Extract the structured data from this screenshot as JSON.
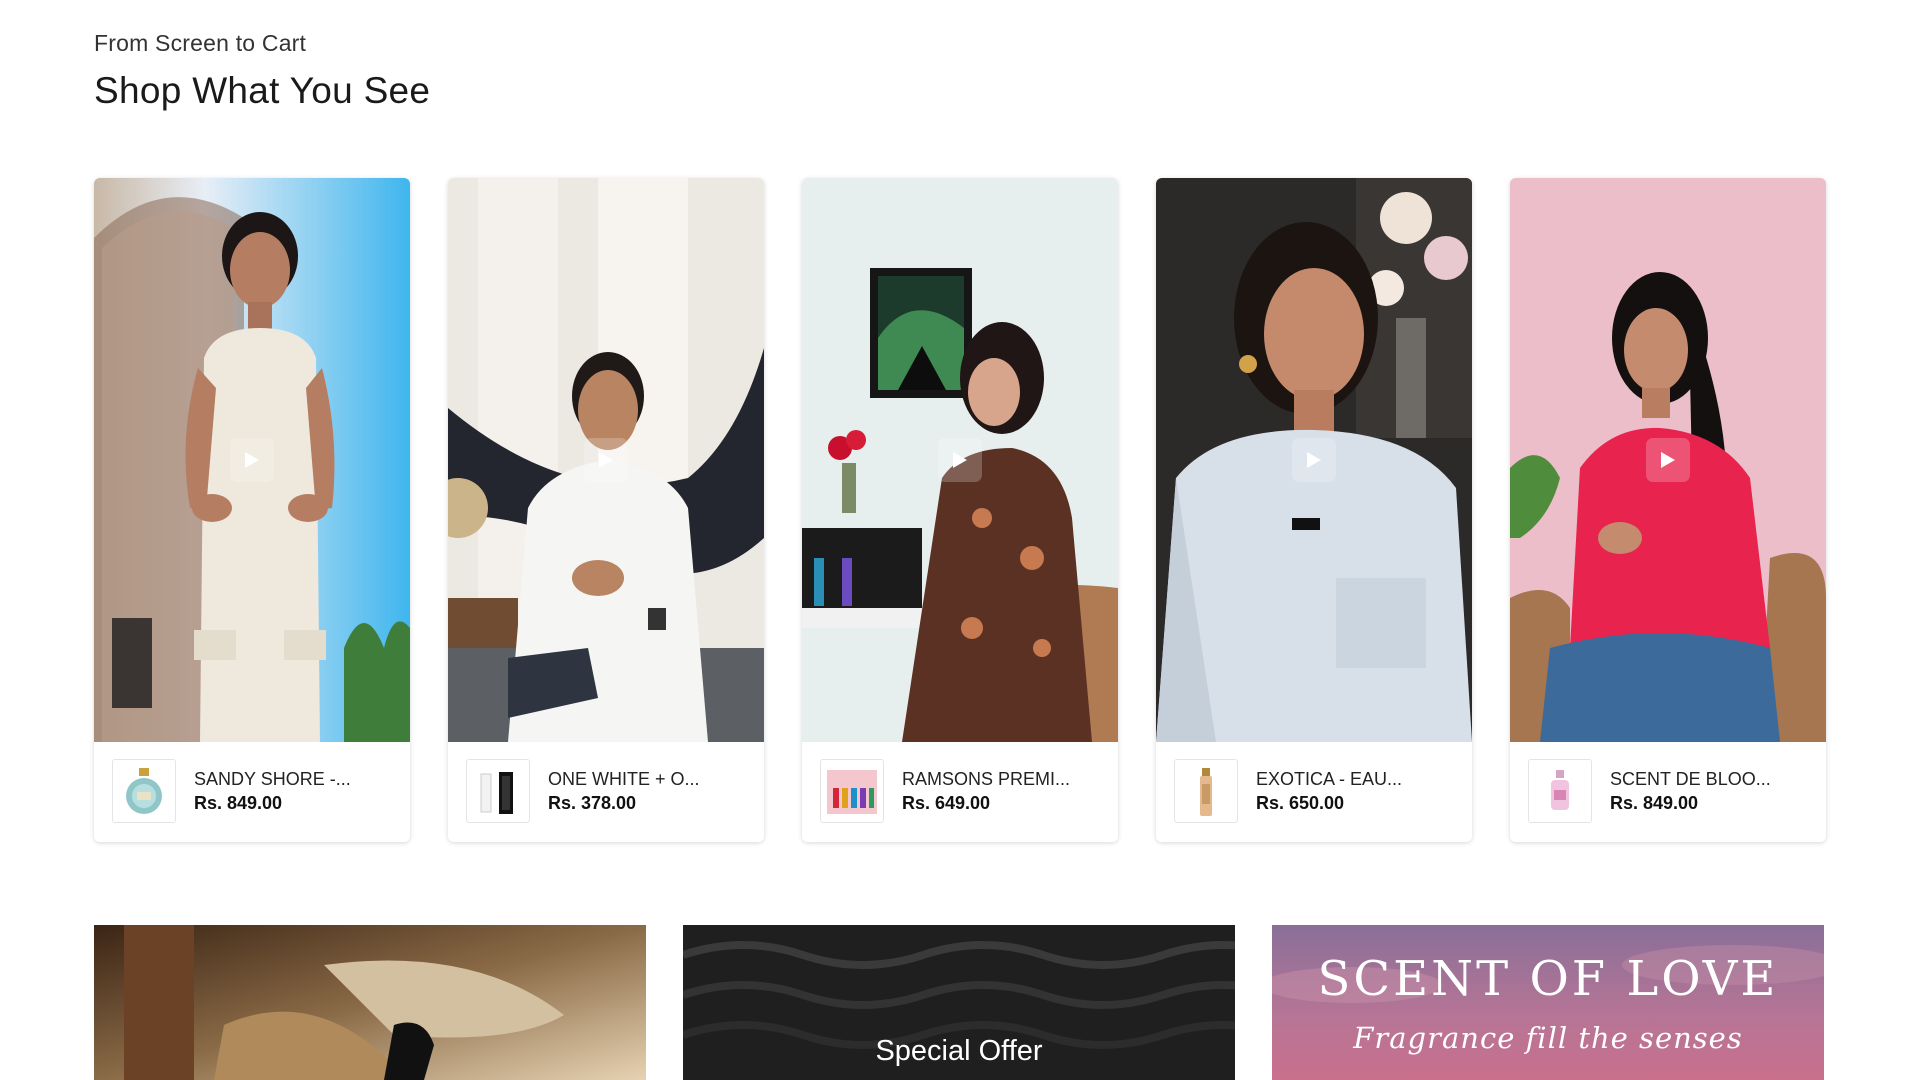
{
  "section": {
    "eyebrow": "From Screen to Cart",
    "title": "Shop What You See"
  },
  "videos": [
    {
      "product_name": "SANDY SHORE -...",
      "price": "Rs. 849.00",
      "icon": "play-icon",
      "backdrop": "#dfe9f4"
    },
    {
      "product_name": "ONE WHITE + O...",
      "price": "Rs. 378.00",
      "icon": "play-icon",
      "backdrop": "#eeeae6"
    },
    {
      "product_name": "RAMSONS PREMI...",
      "price": "Rs. 649.00",
      "icon": "play-icon",
      "backdrop": "#e9f1ef"
    },
    {
      "product_name": "EXOTICA - EAU...",
      "price": "Rs. 650.00",
      "icon": "play-icon",
      "backdrop": "#2b2a28"
    },
    {
      "product_name": "SCENT DE BLOO...",
      "price": "Rs. 849.00",
      "icon": "play-icon",
      "backdrop": "#e6b6c2"
    }
  ],
  "banners": {
    "special_offer": "Special Offer",
    "scent_title": "SCENT OF LOVE",
    "scent_subtitle": "Fragrance fill the senses"
  },
  "colors": {
    "text_primary": "#1a1a1a",
    "card_border_shadow": "#d0d0d0",
    "banner_pink": "#b06a91",
    "banner_dark": "#1e1e1e"
  }
}
